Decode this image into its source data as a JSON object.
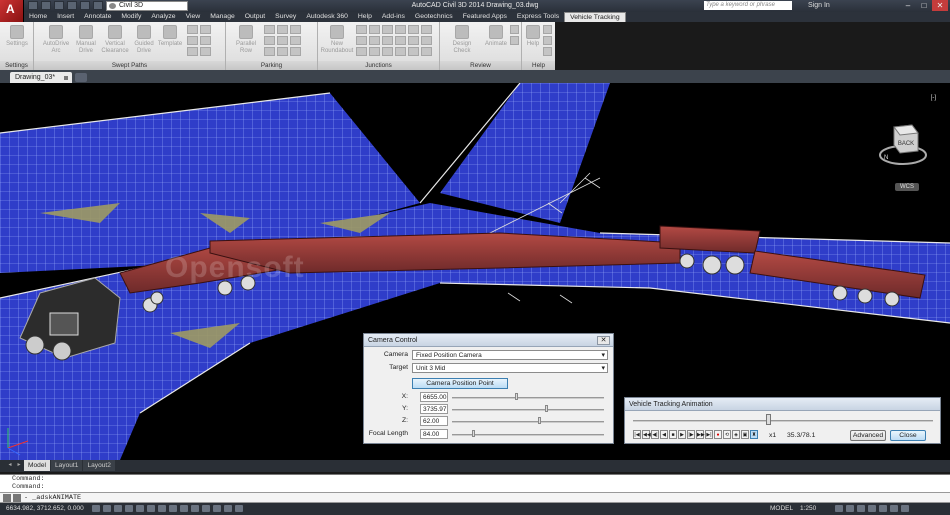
{
  "app": {
    "logo_letter": "A",
    "title": "AutoCAD Civil 3D 2014    Drawing_03.dwg",
    "workspace": "Civil 3D",
    "search_placeholder": "Type a keyword or phrase",
    "signin": "Sign In"
  },
  "menu_tabs": [
    "Home",
    "Insert",
    "Annotate",
    "Modify",
    "Analyze",
    "View",
    "Manage",
    "Output",
    "Survey",
    "Autodesk 360",
    "Help",
    "Add-ins",
    "Geotechnics",
    "Featured Apps",
    "Express Tools",
    "Vehicle Tracking"
  ],
  "ribbon": {
    "settings_btn": "Settings",
    "autodrive": "AutoDrive Arc",
    "manual": "Manual Drive",
    "vertical": "Vertical Clearance",
    "guided": "Guided Drive",
    "template": "Template",
    "parallel": "Parallel Row",
    "new_roundabout": "New Roundabout",
    "design_check": "Design Check",
    "animate": "Animate",
    "help_btn": "Help",
    "panels": [
      "Settings",
      "Swept Paths",
      "Parking",
      "Junctions",
      "Review",
      "Help"
    ]
  },
  "document_tab": "Drawing_03*",
  "viewport": {
    "controls": "[-]",
    "viewcube_label": "BACK",
    "compass": "N",
    "wcs": "WCS",
    "watermark": "Opensoft"
  },
  "layout_tabs": [
    "Model",
    "Layout1",
    "Layout2"
  ],
  "command": {
    "history": [
      "Command:",
      "Command:"
    ],
    "current": "- _adskANIMATE"
  },
  "status": {
    "coords": "6634.982, 3712.652, 0.000",
    "model": "MODEL",
    "scale": "1:250"
  },
  "camera_dialog": {
    "title": "Camera Control",
    "close": "✕",
    "camera_label": "Camera",
    "camera_value": "Fixed Position Camera",
    "target_label": "Target",
    "target_value": "Unit 3 Mid",
    "position_btn": "Camera Position Point",
    "fields": [
      {
        "label": "X:",
        "value": "6655.00",
        "slider": 0.42
      },
      {
        "label": "Y:",
        "value": "3735.97",
        "slider": 0.62
      },
      {
        "label": "Z:",
        "value": "62.00",
        "slider": 0.57
      },
      {
        "label": "Focal Length",
        "value": "84.00",
        "slider": 0.13
      }
    ]
  },
  "anim_dialog": {
    "title": "Vehicle Tracking Animation",
    "progress": 0.45,
    "speed": "x1",
    "time": "35.3/78.1",
    "advanced": "Advanced",
    "close": "Close",
    "controls": [
      "|◀",
      "◀◀",
      "◀|",
      "◀",
      "■",
      "▶",
      "|▶",
      "▶▶",
      "▶|",
      "●",
      "⟲",
      "◈",
      "▣",
      "♜"
    ]
  }
}
